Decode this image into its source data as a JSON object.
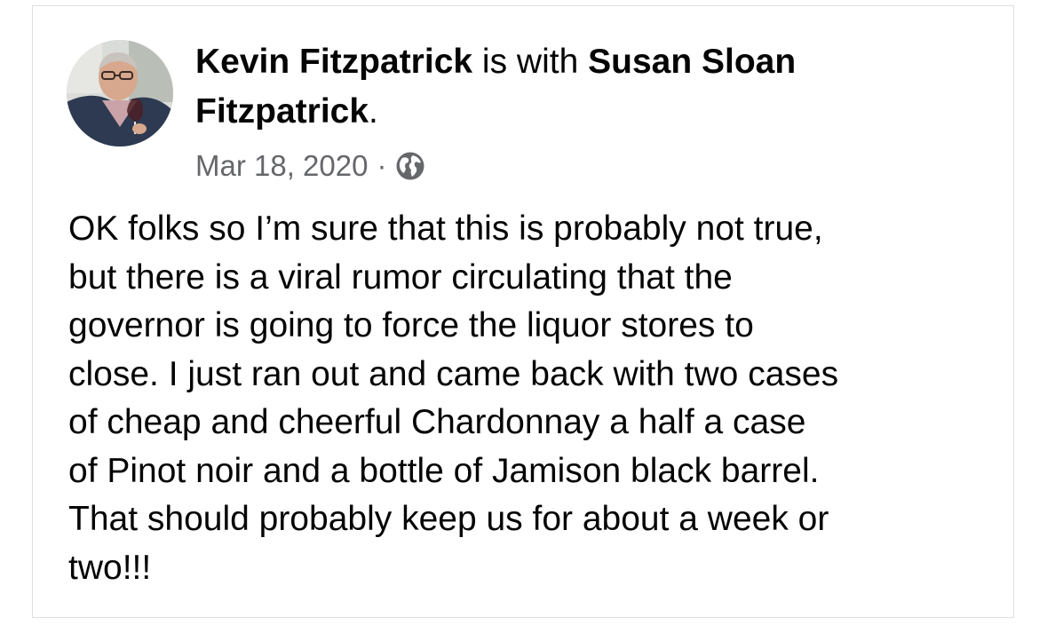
{
  "post": {
    "author_name": "Kevin Fitzpatrick",
    "with_text": "is with",
    "tagged_name": "Susan Sloan Fitzpatrick",
    "tagged_suffix": ".",
    "date": "Mar 18, 2020",
    "separator": "·",
    "privacy_icon": "globe-icon",
    "body": "OK folks so I’m sure that this is probably not true,\nbut there is a viral rumor circulating that the\ngovernor is going to force the liquor stores to\nclose. I just ran out and came back with two cases\nof cheap and cheerful Chardonnay a half a case\nof Pinot noir and a bottle of Jamison black barrel.\nThat should probably keep us for about a week or\ntwo!!!"
  },
  "colors": {
    "text_primary": "#050505",
    "text_secondary": "#65676b",
    "border": "#dddfe2"
  }
}
